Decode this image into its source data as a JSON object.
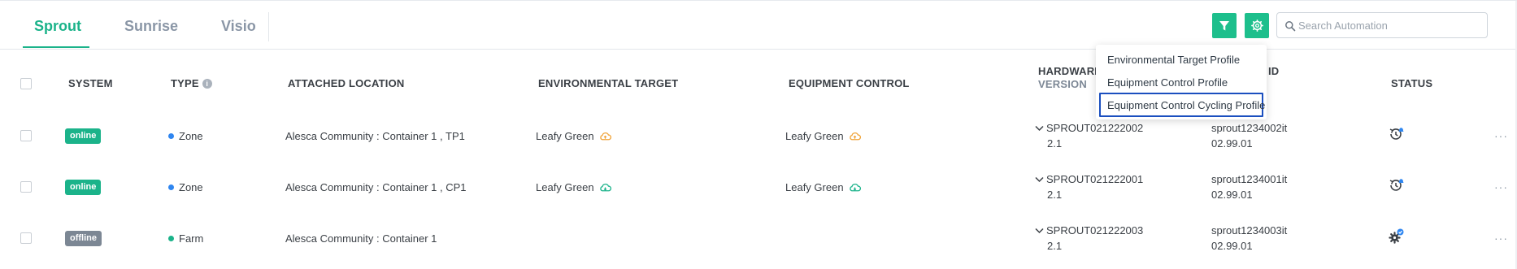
{
  "tabs": [
    {
      "label": "Sprout",
      "active": true
    },
    {
      "label": "Sunrise",
      "active": false
    },
    {
      "label": "Visio",
      "active": false
    }
  ],
  "toolbar": {
    "filter_icon": "filter-icon",
    "settings_icon": "gear-icon",
    "search_placeholder": "Search Automation",
    "accent_color": "#1dbf8c"
  },
  "dropdown": {
    "items": [
      "Environmental Target Profile",
      "Equipment Control Profile",
      "Equipment Control Cycling Profile"
    ],
    "highlighted_index": 2
  },
  "table": {
    "headers": {
      "system": "SYSTEM",
      "type": "TYPE",
      "attached_location": "ATTACHED LOCATION",
      "environmental_target": "ENVIRONMENTAL TARGET",
      "equipment_control": "EQUIPMENT CONTROL",
      "hardware": "HARDWARE",
      "version": "VERSION",
      "id_suffix": "ID",
      "status": "STATUS"
    },
    "rows": [
      {
        "system": "online",
        "type": "Zone",
        "location": "Alesca Community : Container 1 , TP1",
        "env_target": "Leafy Green",
        "equip_control": "Leafy Green",
        "hardware": "SPROUT021222002",
        "version": "2.1",
        "device_id": "sprout1234002it",
        "firmware": "02.99.01",
        "more": "···"
      },
      {
        "system": "online",
        "type": "Zone",
        "location": "Alesca Community : Container 1 , CP1",
        "env_target": "Leafy Green",
        "equip_control": "Leafy Green",
        "hardware": "SPROUT021222001",
        "version": "2.1",
        "device_id": "sprout1234001it",
        "firmware": "02.99.01",
        "more": "···"
      },
      {
        "system": "offline",
        "type": "Farm",
        "location": "Alesca Community : Container 1",
        "env_target": "",
        "equip_control": "",
        "hardware": "SPROUT021222003",
        "version": "2.1",
        "device_id": "sprout1234003it",
        "firmware": "02.99.01",
        "more": "···"
      }
    ]
  },
  "colors": {
    "online": "#1bb38a",
    "offline": "#7c8794",
    "zone_dot": "#2f86f0",
    "farm_dot": "#1bb38a",
    "cloud_orange": "#f0a43a",
    "cloud_green": "#1bb38a",
    "bell_blue": "#2f86f0"
  }
}
